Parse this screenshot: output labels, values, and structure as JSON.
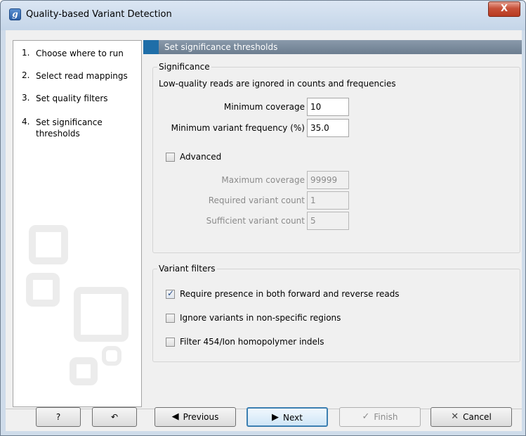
{
  "window": {
    "title": "Quality-based Variant Detection",
    "app_icon_glyph": "g",
    "close_glyph": "X"
  },
  "steps": [
    {
      "num": "1.",
      "label": "Choose where to run"
    },
    {
      "num": "2.",
      "label": "Select read mappings"
    },
    {
      "num": "3.",
      "label": "Set quality filters"
    },
    {
      "num": "4.",
      "label": "Set significance thresholds"
    }
  ],
  "panel": {
    "header": "Set significance thresholds",
    "significance": {
      "title": "Significance",
      "description": "Low-quality reads are ignored in counts and frequencies",
      "min_coverage_label": "Minimum coverage",
      "min_coverage_value": "10",
      "min_freq_label": "Minimum variant frequency (%)",
      "min_freq_value": "35.0",
      "advanced_label": "Advanced",
      "advanced_checked": false,
      "max_coverage_label": "Maximum coverage",
      "max_coverage_value": "99999",
      "required_count_label": "Required variant count",
      "required_count_value": "1",
      "sufficient_count_label": "Sufficient variant count",
      "sufficient_count_value": "5"
    },
    "variant_filters": {
      "title": "Variant filters",
      "items": [
        {
          "label": "Require presence in both forward and reverse reads",
          "checked": true
        },
        {
          "label": "Ignore variants in non-specific regions",
          "checked": false
        },
        {
          "label": "Filter 454/Ion homopolymer indels",
          "checked": false
        }
      ]
    }
  },
  "footer": {
    "help_label": "?",
    "reset_glyph": "↶",
    "previous_label": "Previous",
    "next_label": "Next",
    "finish_label": "Finish",
    "cancel_label": "Cancel"
  },
  "colors": {
    "header_accent": "#1f6ea8",
    "close_button": "#c75139",
    "default_button_border": "#3c7fb1"
  }
}
